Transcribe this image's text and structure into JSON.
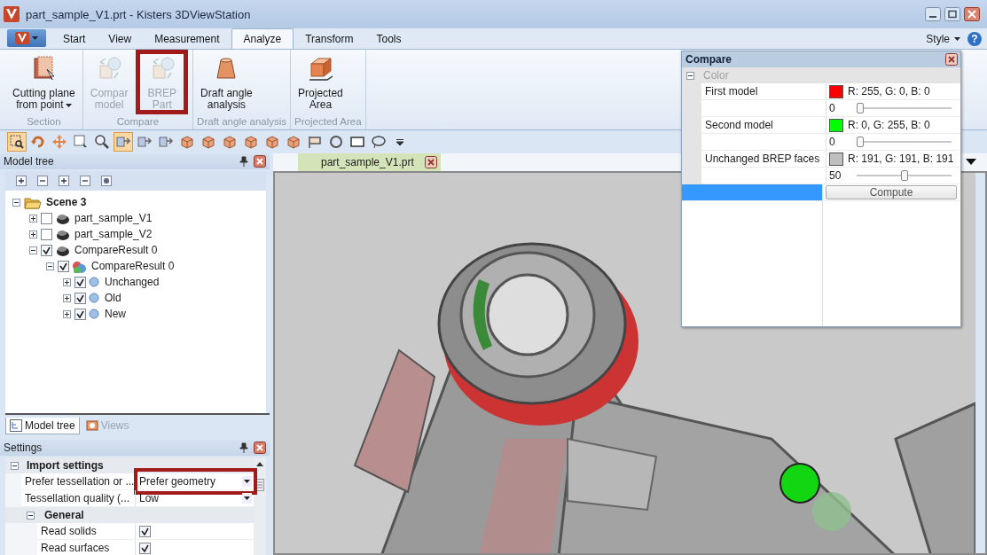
{
  "window": {
    "title": "part_sample_V1.prt - Kisters 3DViewStation"
  },
  "ribbon": {
    "tabs": [
      {
        "label": "Start",
        "selected": false
      },
      {
        "label": "View",
        "selected": false
      },
      {
        "label": "Measurement",
        "selected": false
      },
      {
        "label": "Analyze",
        "selected": true
      },
      {
        "label": "Transform",
        "selected": false
      },
      {
        "label": "Tools",
        "selected": false
      }
    ],
    "style_label": "Style",
    "help_label": "?",
    "groups": [
      {
        "label": "Section",
        "buttons": [
          {
            "kind": "cutting",
            "lines": [
              "Cutting plane",
              "from point"
            ],
            "dropdown": true,
            "disabled": false,
            "highlighted": false
          }
        ]
      },
      {
        "label": "Compare",
        "buttons": [
          {
            "kind": "compare",
            "lines": [
              "Compar",
              "model"
            ],
            "dropdown": false,
            "disabled": true,
            "highlighted": false
          },
          {
            "kind": "compare",
            "lines": [
              "BREP",
              "Part"
            ],
            "dropdown": false,
            "disabled": true,
            "highlighted": true
          }
        ]
      },
      {
        "label": "Draft angle analysis",
        "buttons": [
          {
            "kind": "draft",
            "lines": [
              "Draft angle",
              "analysis"
            ],
            "dropdown": false,
            "disabled": false,
            "highlighted": false
          }
        ]
      },
      {
        "label": "Projected Area",
        "buttons": [
          {
            "kind": "box",
            "lines": [
              "Projected",
              "Area"
            ],
            "dropdown": false,
            "disabled": false,
            "highlighted": false
          }
        ]
      }
    ]
  },
  "quick_toolbar": [
    {
      "kind": "zoom-box",
      "selected": true
    },
    {
      "kind": "rotate",
      "selected": false
    },
    {
      "kind": "pan",
      "selected": false
    },
    {
      "kind": "select",
      "selected": false
    },
    {
      "kind": "zoom",
      "selected": false
    },
    {
      "kind": "pick",
      "selected": true
    },
    {
      "kind": "pick",
      "selected": false
    },
    {
      "kind": "pick",
      "selected": false
    },
    {
      "kind": "cube",
      "selected": false
    },
    {
      "kind": "cube",
      "selected": false
    },
    {
      "kind": "cube",
      "selected": false
    },
    {
      "kind": "cube",
      "selected": false
    },
    {
      "kind": "cube",
      "selected": false
    },
    {
      "kind": "cube",
      "selected": false
    },
    {
      "kind": "flag",
      "selected": false
    },
    {
      "kind": "circle",
      "selected": false
    },
    {
      "kind": "rect",
      "selected": false
    },
    {
      "kind": "lasso",
      "selected": false
    },
    {
      "kind": "more",
      "selected": false
    }
  ],
  "model_tree": {
    "title": "Model tree",
    "items": [
      {
        "label": "Scene 3",
        "kind": "folder",
        "expanded": true,
        "children": [
          {
            "label": "part_sample_V1",
            "kind": "part",
            "checked": false,
            "expanded": false
          },
          {
            "label": "part_sample_V2",
            "kind": "part",
            "checked": false,
            "expanded": false
          },
          {
            "label": "CompareResult 0",
            "kind": "part",
            "checked": true,
            "expanded": true,
            "children": [
              {
                "label": "CompareResult 0",
                "kind": "result",
                "checked": true,
                "expanded": true,
                "children": [
                  {
                    "label": "Unchanged",
                    "kind": "body",
                    "checked": true,
                    "expanded": false
                  },
                  {
                    "label": "Old",
                    "kind": "body",
                    "checked": true,
                    "expanded": false
                  },
                  {
                    "label": "New",
                    "kind": "body",
                    "checked": true,
                    "expanded": false
                  }
                ]
              }
            ]
          }
        ]
      }
    ],
    "tabs": [
      {
        "label": "Model tree",
        "selected": true,
        "disabled": false
      },
      {
        "label": "Views",
        "selected": false,
        "disabled": true
      }
    ]
  },
  "settings": {
    "title": "Settings",
    "rows": [
      {
        "kind": "section",
        "label": "Import settings",
        "expanded": true
      },
      {
        "kind": "dropdown",
        "label": "Prefer tessellation or ...",
        "value": "Prefer geometry",
        "highlighted": true
      },
      {
        "kind": "dropdown",
        "label": "Tessellation quality (...",
        "value": "Low",
        "highlighted": false
      },
      {
        "kind": "subsection",
        "label": "General",
        "expanded": true
      },
      {
        "kind": "checkbox",
        "label": "Read solids",
        "checked": true
      },
      {
        "kind": "checkbox",
        "label": "Read surfaces",
        "checked": true
      }
    ]
  },
  "document_tabs": [
    {
      "label": "part_sample_V1.prt",
      "selected": true
    }
  ],
  "compare_panel": {
    "title": "Compare",
    "section": "Color",
    "expanded": true,
    "rows": [
      {
        "label": "First model",
        "color": "#ff0000",
        "rgb": "R: 255, G: 0, B: 0",
        "transparency": "0",
        "level": 0
      },
      {
        "label": "Second model",
        "color": "#00ff00",
        "rgb": "R: 0, G: 255, B: 0",
        "transparency": "0",
        "level": 0
      },
      {
        "label": "Unchanged BREP faces",
        "color": "#bfbfbf",
        "rgb": "R: 191, G: 191, B: 191",
        "transparency": "50",
        "level": 0.5
      }
    ],
    "button": "Compute"
  }
}
